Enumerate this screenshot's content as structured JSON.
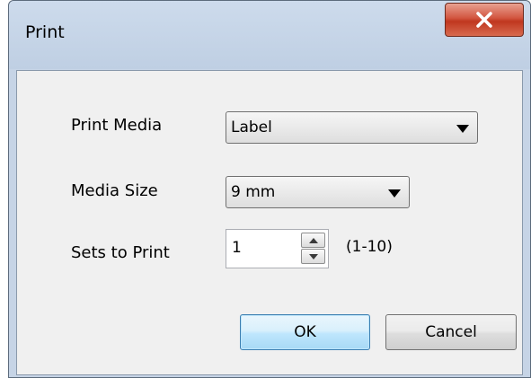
{
  "dialog": {
    "title": "Print",
    "close_icon": "close-x-icon"
  },
  "form": {
    "print_media": {
      "label": "Print Media",
      "value": "Label"
    },
    "media_size": {
      "label": "Media Size",
      "value": "9 mm"
    },
    "sets_to_print": {
      "label": "Sets to Print",
      "value": "1",
      "range": "(1-10)"
    }
  },
  "buttons": {
    "ok": "OK",
    "cancel": "Cancel"
  },
  "colors": {
    "accent": "#3c7fb1",
    "close_red": "#c0371f"
  }
}
